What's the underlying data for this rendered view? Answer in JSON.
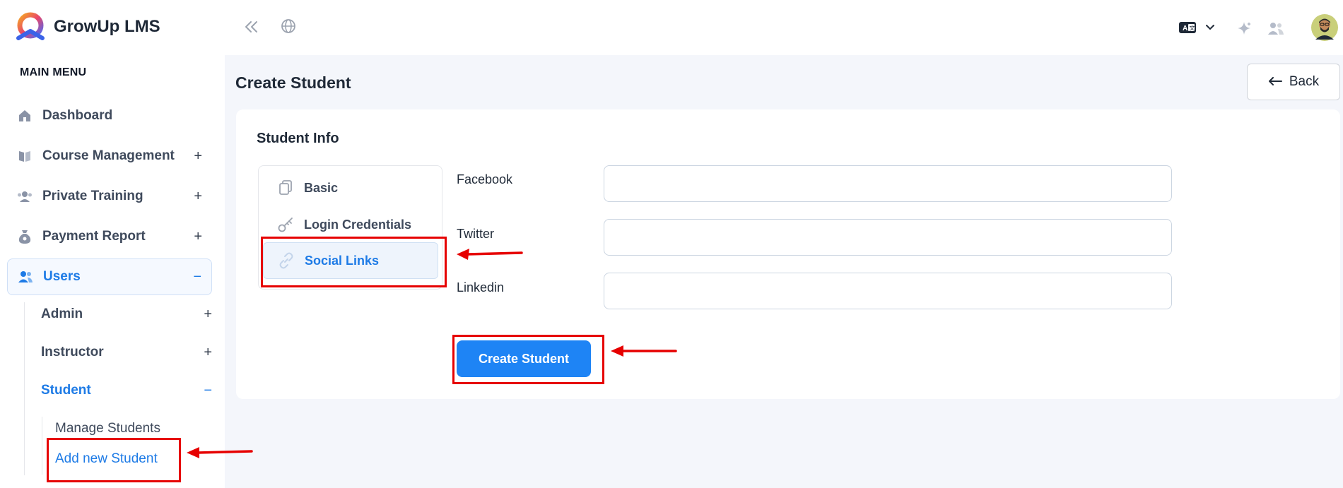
{
  "brand": {
    "name": "GrowUp LMS"
  },
  "sidebar": {
    "menu_heading": "MAIN MENU",
    "items": [
      {
        "label": "Dashboard",
        "icon": "home-icon",
        "toggle": ""
      },
      {
        "label": "Course Management",
        "icon": "book-icon",
        "toggle": "+"
      },
      {
        "label": "Private Training",
        "icon": "training-icon",
        "toggle": "+"
      },
      {
        "label": "Payment Report",
        "icon": "money-bag-icon",
        "toggle": "+"
      },
      {
        "label": "Users",
        "icon": "users-icon",
        "toggle": "−"
      }
    ],
    "users_sub": [
      {
        "label": "Admin",
        "toggle": "+"
      },
      {
        "label": "Instructor",
        "toggle": "+"
      },
      {
        "label": "Student",
        "toggle": "−"
      }
    ],
    "student_sub": [
      {
        "label": "Manage Students"
      },
      {
        "label": "Add new Student"
      }
    ]
  },
  "topbar": {
    "icons": [
      "collapse-sidebar-icon",
      "globe-icon",
      "language-icon",
      "chevron-down-icon",
      "sparkle-icon",
      "users-switch-icon",
      "avatar"
    ]
  },
  "page": {
    "title": "Create Student",
    "back_label": "Back"
  },
  "card": {
    "title": "Student Info",
    "tabs": [
      {
        "label": "Basic",
        "icon": "copy-icon"
      },
      {
        "label": "Login Credentials",
        "icon": "key-icon"
      },
      {
        "label": "Social Links",
        "icon": "link-icon"
      }
    ],
    "fields": [
      {
        "label": "Facebook",
        "value": "",
        "placeholder": ""
      },
      {
        "label": "Twitter",
        "value": "",
        "placeholder": ""
      },
      {
        "label": "Linkedin",
        "value": "",
        "placeholder": ""
      }
    ],
    "submit_label": "Create Student"
  },
  "colors": {
    "accent": "#1e84f5",
    "annotation": "#e60000"
  }
}
